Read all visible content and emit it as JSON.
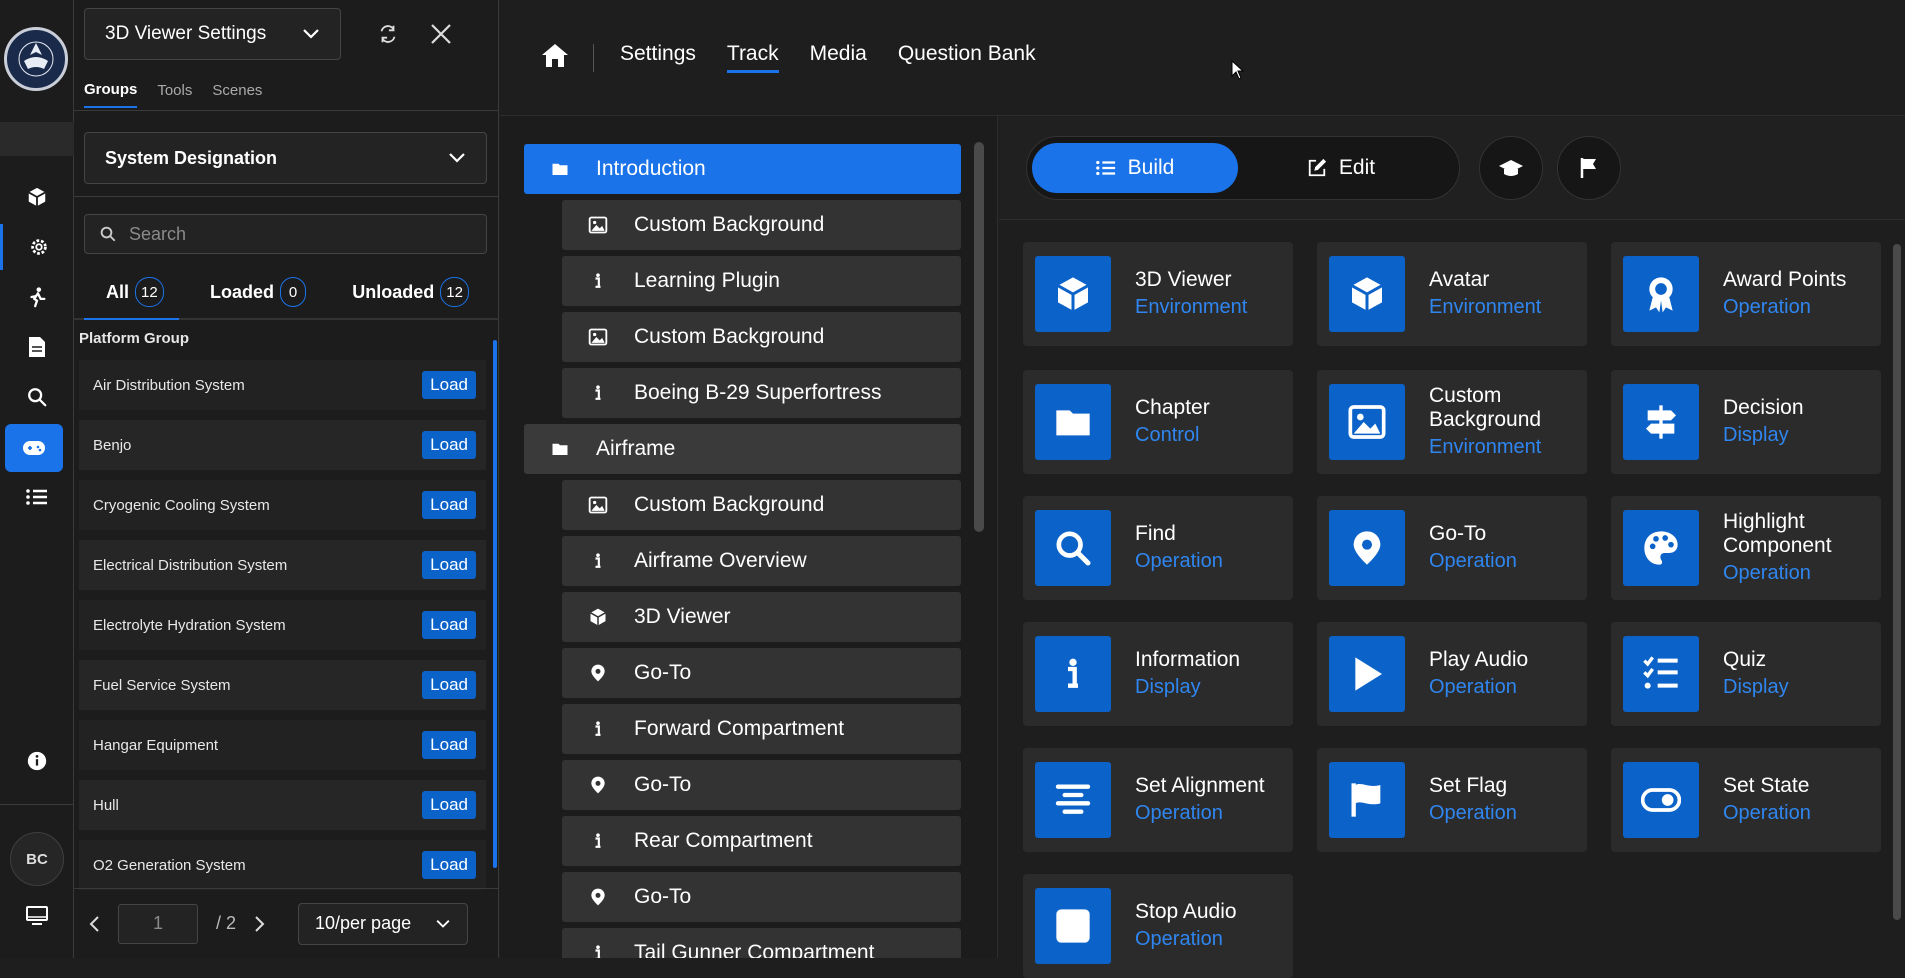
{
  "rail": {
    "avatar_initials": "BC",
    "icons": [
      "cube-icon",
      "gear-icon",
      "walk-icon",
      "document-icon",
      "search-icon",
      "gamepad-icon",
      "list-icon",
      "info-icon",
      "monitor-icon"
    ]
  },
  "panel": {
    "title_select": "3D Viewer Settings",
    "tabs": [
      "Groups",
      "Tools",
      "Scenes"
    ],
    "group_select": "System Designation",
    "search_placeholder": "Search",
    "filters": [
      {
        "label": "All",
        "count": "12"
      },
      {
        "label": "Loaded",
        "count": "0"
      },
      {
        "label": "Unloaded",
        "count": "12"
      }
    ],
    "group_title": "Platform Group",
    "load_label": "Load",
    "systems": [
      "Air Distribution System",
      "Benjo",
      "Cryogenic Cooling System",
      "Electrical Distribution System",
      "Electrolyte Hydration System",
      "Fuel Service System",
      "Hangar Equipment",
      "Hull",
      "O2 Generation System"
    ],
    "pager": {
      "page": "1",
      "total": "/ 2",
      "per_page": "10/per page"
    }
  },
  "nav": {
    "items": [
      "Settings",
      "Track",
      "Media",
      "Question Bank"
    ],
    "active": "Track"
  },
  "tree": [
    {
      "type": "folder",
      "label": "Introduction",
      "icon": "folder-icon",
      "selected": true
    },
    {
      "type": "child",
      "label": "Custom Background",
      "icon": "image-icon"
    },
    {
      "type": "child",
      "label": "Learning Plugin",
      "icon": "info-icon"
    },
    {
      "type": "child",
      "label": "Custom Background",
      "icon": "image-icon"
    },
    {
      "type": "child",
      "label": "Boeing B-29 Superfortress",
      "icon": "info-icon"
    },
    {
      "type": "folder",
      "label": "Airframe",
      "icon": "folder-icon"
    },
    {
      "type": "child",
      "label": "Custom Background",
      "icon": "image-icon"
    },
    {
      "type": "child",
      "label": "Airframe Overview",
      "icon": "info-icon"
    },
    {
      "type": "child",
      "label": "3D Viewer",
      "icon": "cube-icon"
    },
    {
      "type": "child",
      "label": "Go-To",
      "icon": "pin-icon"
    },
    {
      "type": "child",
      "label": "Forward Compartment",
      "icon": "info-icon"
    },
    {
      "type": "child",
      "label": "Go-To",
      "icon": "pin-icon"
    },
    {
      "type": "child",
      "label": "Rear Compartment",
      "icon": "info-icon"
    },
    {
      "type": "child",
      "label": "Go-To",
      "icon": "pin-icon"
    },
    {
      "type": "child",
      "label": "Tail Gunner Compartment",
      "icon": "info-icon"
    }
  ],
  "toolbar": {
    "build_label": "Build",
    "edit_label": "Edit"
  },
  "components": [
    {
      "name": "3D Viewer",
      "type": "Environment",
      "icon": "cube-icon"
    },
    {
      "name": "Avatar",
      "type": "Environment",
      "icon": "cube-icon"
    },
    {
      "name": "Award Points",
      "type": "Operation",
      "icon": "award-icon"
    },
    {
      "name": "Chapter",
      "type": "Control",
      "icon": "folder-icon"
    },
    {
      "name": "Custom Background",
      "type": "Environment",
      "icon": "image-icon"
    },
    {
      "name": "Decision",
      "type": "Display",
      "icon": "signpost-icon"
    },
    {
      "name": "Find",
      "type": "Operation",
      "icon": "search-icon"
    },
    {
      "name": "Go-To",
      "type": "Operation",
      "icon": "pin-icon"
    },
    {
      "name": "Highlight Component",
      "type": "Operation",
      "icon": "palette-icon"
    },
    {
      "name": "Information",
      "type": "Display",
      "icon": "info-icon"
    },
    {
      "name": "Play Audio",
      "type": "Operation",
      "icon": "play-icon"
    },
    {
      "name": "Quiz",
      "type": "Display",
      "icon": "checklist-icon"
    },
    {
      "name": "Set Alignment",
      "type": "Operation",
      "icon": "align-icon"
    },
    {
      "name": "Set Flag",
      "type": "Operation",
      "icon": "flag-icon"
    },
    {
      "name": "Set State",
      "type": "Operation",
      "icon": "toggle-icon"
    },
    {
      "name": "Stop Audio",
      "type": "Operation",
      "icon": "stop-icon"
    }
  ],
  "colors": {
    "accent": "#1a73e8",
    "card_icon_bg": "#0b63c9",
    "type_text": "#2f86f0"
  }
}
